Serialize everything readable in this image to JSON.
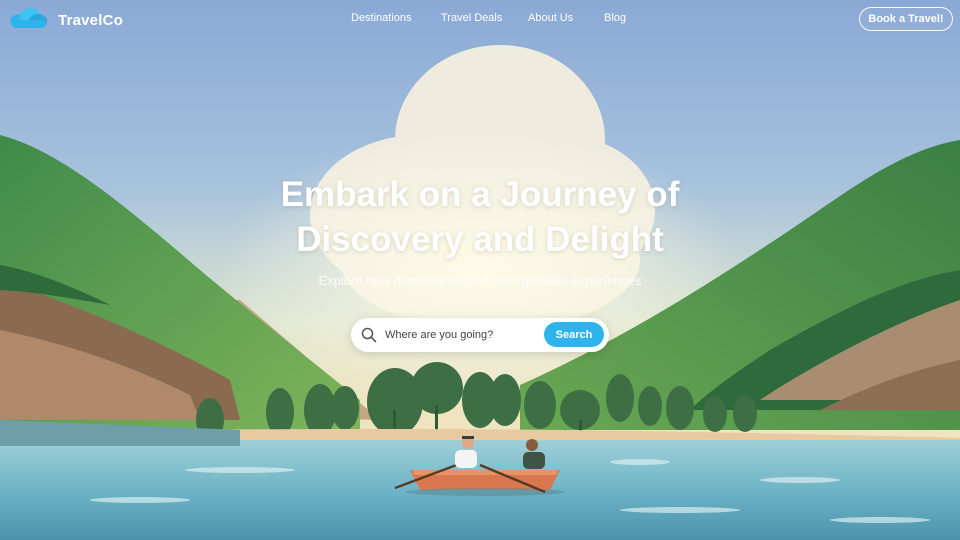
{
  "brand": {
    "name": "TravelCo",
    "logo_icon": "cloud-icon",
    "accent": "#2db4ea"
  },
  "nav": {
    "links": [
      "Destinations",
      "Travel Deals",
      "About Us",
      "Blog"
    ],
    "cta": "Book a Travel!"
  },
  "hero": {
    "title_line1": "Embark on a Journey of",
    "title_line2": "Discovery and Delight",
    "subtitle": "Explore new destinations and unforgettable experiences"
  },
  "search": {
    "placeholder": "Where are you going?",
    "button": "Search",
    "icon": "search-icon"
  }
}
